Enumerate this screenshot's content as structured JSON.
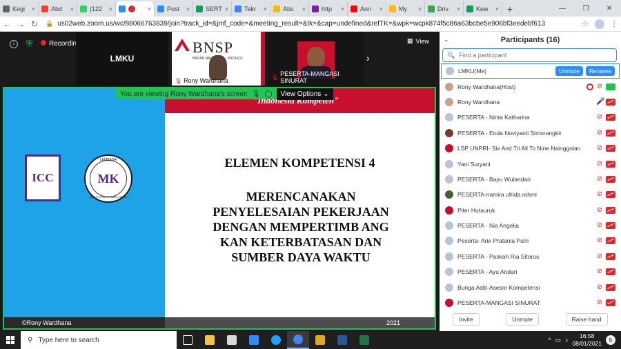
{
  "browser": {
    "tabs": [
      {
        "label": "Kegi",
        "favicon_color": "#5f6368"
      },
      {
        "label": "Abd",
        "favicon_color": "#ea4335"
      },
      {
        "label": "(122",
        "favicon_color": "#25d366"
      },
      {
        "label": "",
        "favicon_color": "#2d8cff"
      },
      {
        "label": "Post",
        "favicon_color": "#2d8cff"
      },
      {
        "label": "SERT",
        "favicon_color": "#0f9d58"
      },
      {
        "label": "Tekr",
        "favicon_color": "#4285f4"
      },
      {
        "label": "Abs",
        "favicon_color": "#fbbc04"
      },
      {
        "label": "http",
        "favicon_color": "#7b1fa2"
      },
      {
        "label": "Ann",
        "favicon_color": "#ff0000"
      },
      {
        "label": "My",
        "favicon_color": "#fbbc04"
      },
      {
        "label": "Driv",
        "favicon_color": "#34a853"
      },
      {
        "label": "Kew",
        "favicon_color": "#0f9d58"
      }
    ],
    "url": "us02web.zoom.us/wc/86066763839/join?track_id=&jmf_code=&meeting_result=&tk=&cap=undefined&refTK=&wpk=wcpk874f5c86a63bcbe5e906bf3eedebf613"
  },
  "zoom": {
    "recording_label": "Recording",
    "view_label": "View",
    "thumbs": [
      {
        "name": "LMKU"
      },
      {
        "name": "Rony Wardhana",
        "bnsp_text": "BNSP",
        "bnsp_sub": "BADAN NASIONAL ... PROFESI",
        "bnsp_overlay": "Indonesia Kompeten"
      },
      {
        "name": "PESERTA-MANGASI SINURAT"
      }
    ],
    "share_banner": "You are viewing Rony Wardhana's screen",
    "view_options": "View Options",
    "slide": {
      "tagline": "\"Indonesia Kompeten\"",
      "icc": "ICC",
      "lembaga_top": "LEMBAGA",
      "lembaga_mk": "MK",
      "lembaga_bottom": "MULTI KOMPETENSI UTAMA",
      "title": "ELEMEN KOMPETENSI 4",
      "body_lines": [
        "MERENCANAKAN",
        "PENYELESAIAN PEKERJAAN",
        "DENGAN MEMPERTIMB ANG",
        "KAN KETERBATASAN DAN",
        "SUMBER DAYA WAKTU"
      ],
      "copyright": "©Rony Wardhana",
      "year": "2021"
    }
  },
  "participants": {
    "title": "Participants (16)",
    "search_placeholder": "Find a participant",
    "me": {
      "name": "LMKU(Me)",
      "unmute": "Unmute",
      "rename": "Rename"
    },
    "list": [
      {
        "name": "Rony Wardhana(Host)",
        "mic": "off",
        "cam": "on",
        "rec": true,
        "avatar": "#c7a28a"
      },
      {
        "name": "Rony Wardhana",
        "mic": "on",
        "cam": "off",
        "avatar": "#c7a28a"
      },
      {
        "name": "PESERTA - Ninta Katharina",
        "mic": "off",
        "cam": "off",
        "avatar": "#b7c4d3"
      },
      {
        "name": "PESERTA - Enda Noviyanti Simorangkir",
        "mic": "off",
        "cam": "off",
        "avatar": "#7a3b2e"
      },
      {
        "name": "LSP UNPRI- Six And Tri All To Nine Nainggolan",
        "mic": "off",
        "cam": "off",
        "avatar": "#c8102e"
      },
      {
        "name": "Yani Suryani",
        "mic": "off",
        "cam": "off",
        "avatar": "#b7c4d3"
      },
      {
        "name": "PESERTA - Bayu Wulandari",
        "mic": "off",
        "cam": "off",
        "avatar": "#b7c4d3"
      },
      {
        "name": "PESERTA-namira ufrida rahmi",
        "mic": "off",
        "cam": "off",
        "avatar": "#4a5d3a"
      },
      {
        "name": "Piter Hutauruk",
        "mic": "off",
        "cam": "off",
        "avatar": "#c8102e"
      },
      {
        "name": "PESERTA - Nia Angelia",
        "mic": "off",
        "cam": "off",
        "avatar": "#b7c4d3"
      },
      {
        "name": "Peserta- Arie Pratania Putri",
        "mic": "off",
        "cam": "off",
        "avatar": "#b7c4d3"
      },
      {
        "name": "PESERTA - Paskah Ria Sitorus",
        "mic": "off",
        "cam": "off",
        "avatar": "#b7c4d3"
      },
      {
        "name": "PESERTA - Ayu Andari",
        "mic": "off",
        "cam": "off",
        "avatar": "#b7c4d3"
      },
      {
        "name": "Bunga Aditi-Asesor Kompetensi",
        "mic": "off",
        "cam": "off",
        "avatar": "#b7c4d3"
      },
      {
        "name": "PESERTA-MANGASI SINURAT",
        "mic": "off",
        "cam": "off",
        "avatar": "#c8102e"
      }
    ],
    "footer": {
      "invite": "Invite",
      "unmute": "Unmute",
      "raise": "Raise hand"
    }
  },
  "taskbar": {
    "search_placeholder": "Type here to search",
    "apps": [
      "task-view",
      "file-explorer",
      "store",
      "mail",
      "edge",
      "chrome",
      "media",
      "word",
      "excel"
    ],
    "app_colors": [
      "#ffffff",
      "#f4c542",
      "#d9d9d9",
      "#2d8cff",
      "#1aa3ff",
      "#4285f4",
      "#e0a81a",
      "#2b579a",
      "#217346"
    ],
    "time": "16:58",
    "date": "08/01/2021",
    "notif_count": "5"
  }
}
